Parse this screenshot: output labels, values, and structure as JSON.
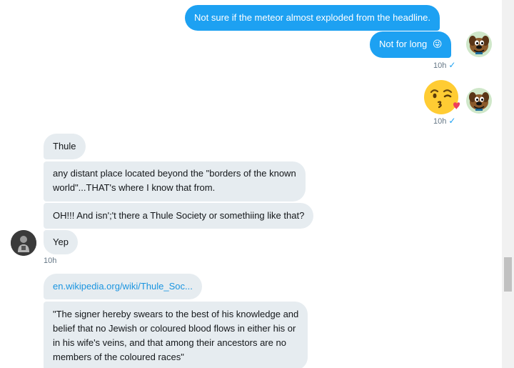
{
  "sent": {
    "msg1": "Not sure if the meteor almost exploded from the headline.",
    "msg2": "Not for long",
    "msg2_emoji": "😜",
    "time1": "10h",
    "time2": "10h",
    "check": "✓"
  },
  "received": {
    "msg1": "Thule",
    "msg2_line1": "any distant place located beyond the \"borders of the known",
    "msg2_line2": "world\"...THAT's where I know that from.",
    "msg3": "OH!!! And isn';'t there a Thule Society or somethiing like that?",
    "msg4": "Yep",
    "time": "10h",
    "link": "en.wikipedia.org/wiki/Thule_Soc...",
    "quote_line1": "\"The signer hereby swears to the best of his knowledge and",
    "quote_line2": "belief that no Jewish or coloured blood flows in either his or",
    "quote_line3": "in his wife's veins, and that among their ancestors are no",
    "quote_line4": "members of the coloured races\""
  },
  "icons": {
    "my_avatar": "scooby-doo-avatar",
    "their_avatar": "dark-figure-avatar",
    "kiss_emoji": "face-blowing-kiss-emoji"
  },
  "colors": {
    "sent_bubble": "#1da1f2",
    "received_bubble": "#e6ecf0",
    "meta_text": "#657786"
  }
}
